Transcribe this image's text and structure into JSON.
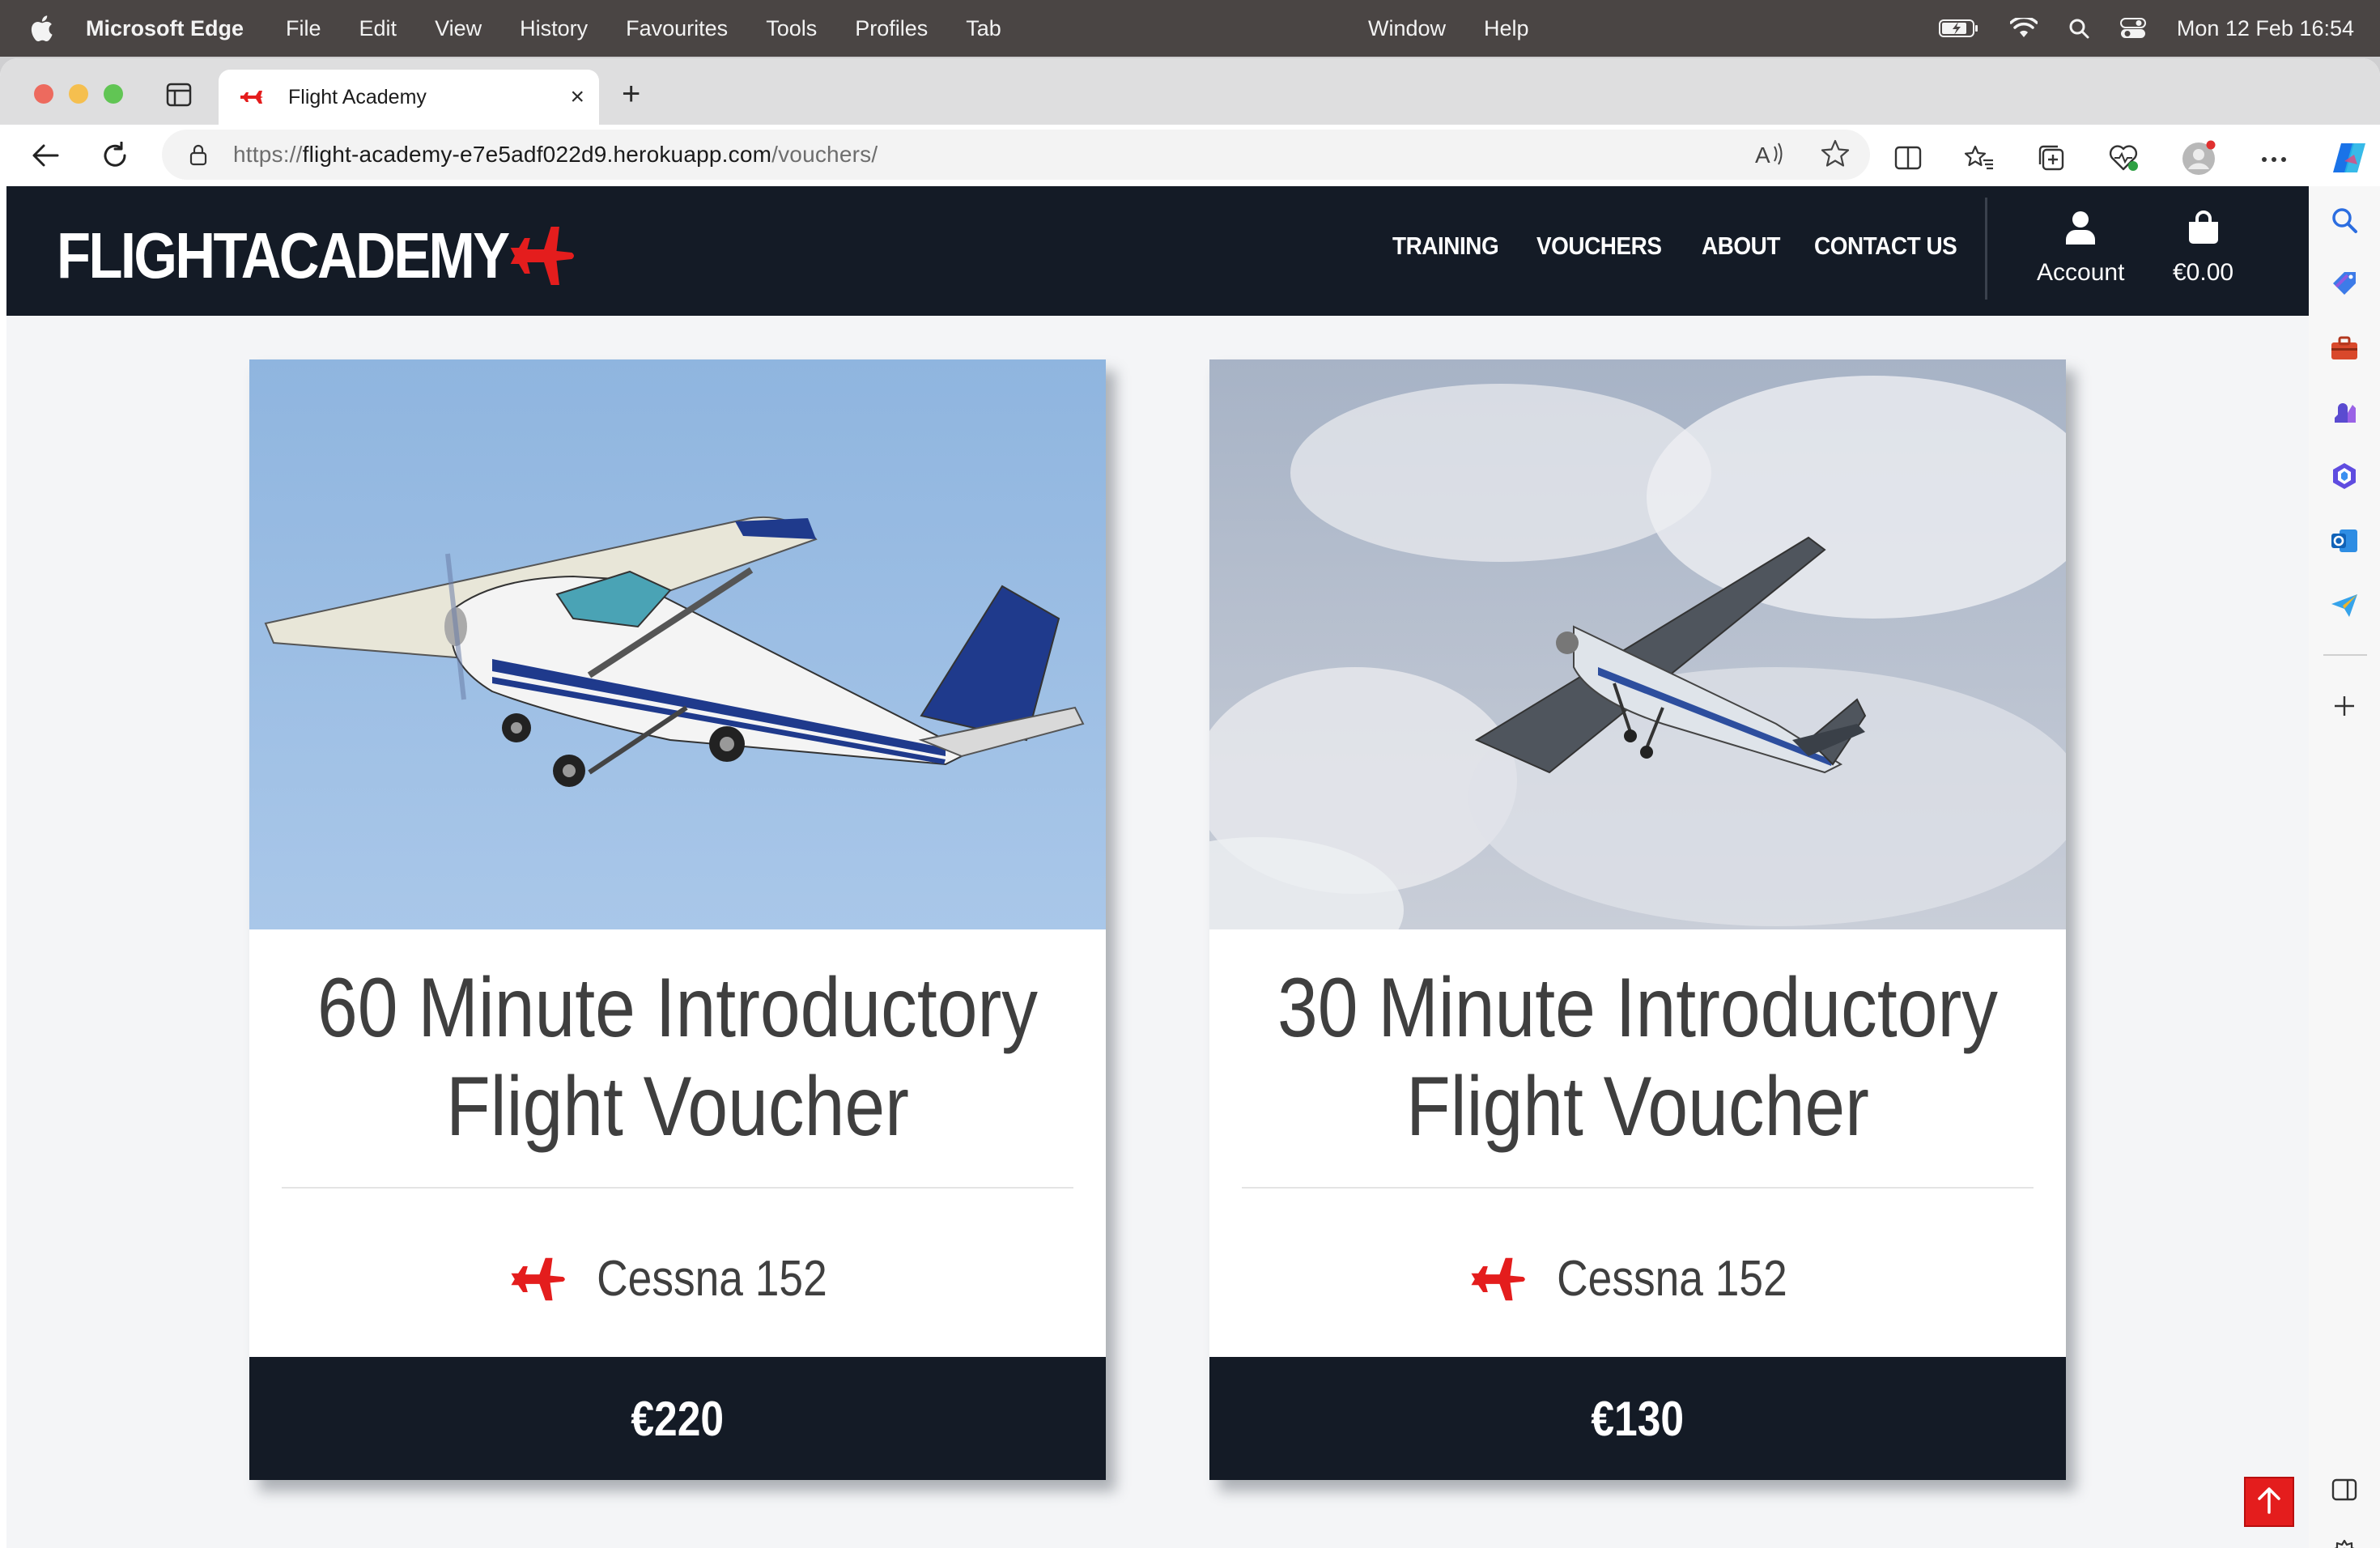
{
  "menubar": {
    "app": "Microsoft Edge",
    "items": [
      "File",
      "Edit",
      "View",
      "History",
      "Favourites",
      "Tools",
      "Profiles",
      "Tab"
    ],
    "center_items": [
      "Window",
      "Help"
    ],
    "clock": "Mon 12 Feb  16:54"
  },
  "browser": {
    "tab_title": "Flight Academy",
    "url_scheme": "https://",
    "url_host": "flight-academy-e7e5adf022d9.herokuapp.com",
    "url_path": "/vouchers/"
  },
  "site": {
    "logo": "FLIGHTACADEMY",
    "nav": [
      "TRAINING",
      "VOUCHERS",
      "ABOUT",
      "CONTACT US"
    ],
    "account_label": "Account",
    "bag_total": "€0.00"
  },
  "vouchers": [
    {
      "title_line1": "60 Minute Introductory",
      "title_line2": "Flight Voucher",
      "aircraft": "Cessna 152",
      "price": "€220"
    },
    {
      "title_line1": "30 Minute Introductory",
      "title_line2": "Flight Voucher",
      "aircraft": "Cessna 152",
      "price": "€130"
    }
  ],
  "colors": {
    "brand_red": "#e41d1d",
    "nav_bg": "#141b26"
  }
}
